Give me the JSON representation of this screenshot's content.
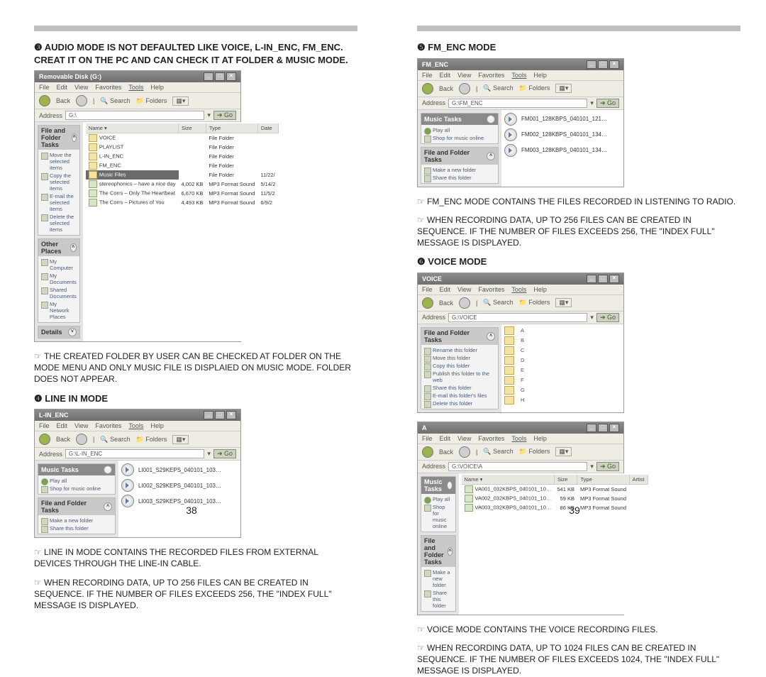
{
  "left": {
    "section3_title": "❸ AUDIO MODE IS NOT DEFAULTED LIKE VOICE, L-IN_ENC, FM_ENC. CREAT IT ON THE PC AND CAN CHECK IT AT FOLDER & MUSIC MODE.",
    "note3": "THE CREATED FOLDER BY USER CAN BE CHECKED AT FOLDER ON THE MODE MENU AND ONLY MUSIC FILE IS DISPLAIED ON MUSIC MODE. FOLDER DOES NOT APPEAR.",
    "section4_title": "❹ LINE IN MODE",
    "note4a": "LINE IN MODE CONTAINS THE RECORDED FILES FROM EXTERNAL DEVICES THROUGH THE LINE-IN CABLE.",
    "note4b": "WHEN RECORDING DATA, UP TO 256 FILES CAN BE CREATED IN SEQUENCE. IF THE NUMBER OF FILES EXCEEDS 256, THE  \"INDEX FULL\" MESSAGE IS DISPLAYED.",
    "page_num": "38",
    "win_g": {
      "title": "Removable Disk (G:)",
      "menu": [
        "File",
        "Edit",
        "View",
        "Favorites",
        "Tools",
        "Help"
      ],
      "back": "Back",
      "search": "Search",
      "folders": "Folders",
      "addr_label": "Address",
      "addr_value": "G:\\",
      "go": "Go",
      "side_tasks_hd": "File and Folder Tasks",
      "side_tasks": [
        "Move the selected items",
        "Copy the selected items",
        "E-mail the selected items",
        "Delete the selected items"
      ],
      "side_places_hd": "Other Places",
      "side_places": [
        "My Computer",
        "My Documents",
        "Shared Documents",
        "My Network Places"
      ],
      "side_details_hd": "Details",
      "cols": [
        "Name",
        "Size",
        "Type",
        "Date"
      ],
      "rows": [
        {
          "name": "VOICE",
          "size": "",
          "type": "File Folder",
          "date": ""
        },
        {
          "name": "PLAYLIST",
          "size": "",
          "type": "File Folder",
          "date": ""
        },
        {
          "name": "L-IN_ENC",
          "size": "",
          "type": "File Folder",
          "date": ""
        },
        {
          "name": "FM_ENC",
          "size": "",
          "type": "File Folder",
          "date": ""
        },
        {
          "name": "Music Files",
          "size": "",
          "type": "File Folder",
          "date": "11/22/",
          "sel": true
        },
        {
          "name": "stereophonics – have a nice day",
          "size": "4,002 KB",
          "type": "MP3 Format Sound",
          "date": "5/14/2"
        },
        {
          "name": "The Corrs – Only The Heartbeat",
          "size": "6,670 KB",
          "type": "MP3 Format Sound",
          "date": "11/5/2"
        },
        {
          "name": "The Corrs – Pictures of You",
          "size": "4,493 KB",
          "type": "MP3 Format Sound",
          "date": "6/9/2"
        }
      ]
    },
    "win_lin": {
      "title": "L-IN_ENC",
      "addr_value": "G:\\L-IN_ENC",
      "side_music_hd": "Music Tasks",
      "side_music": [
        "Play all",
        "Shop for music online"
      ],
      "side_tasks_hd": "File and Folder Tasks",
      "side_tasks": [
        "Make a new folder",
        "Share this folder"
      ],
      "items": [
        "LI001_S29KEPS_040101_103…",
        "LI002_S29KEPS_040101_103…",
        "LI003_S29KEPS_040101_103…"
      ]
    }
  },
  "right": {
    "section5_title": "❺ FM_ENC MODE",
    "note5a": "FM_ENC MODE CONTAINS THE FILES RECORDED IN LISTENING TO RADIO.",
    "note5b": "WHEN RECORDING DATA, UP TO 256 FILES CAN BE CREATED IN SEQUENCE. IF THE NUMBER OF FILES EXCEEDS 256, THE  \"INDEX FULL\" MESSAGE IS DISPLAYED.",
    "section6_title": "❻ VOICE MODE",
    "note6a": "VOICE MODE CONTAINS THE VOICE RECORDING FILES.",
    "note6b": "WHEN RECORDING DATA, UP TO 1024 FILES CAN BE CREATED IN SEQUENCE. IF THE NUMBER OF FILES EXCEEDS 1024, THE  \"INDEX FULL\" MESSAGE IS DISPLAYED.",
    "page_num": "39",
    "win_fm": {
      "title": "FM_ENC",
      "addr_value": "G:\\FM_ENC",
      "side_music_hd": "Music Tasks",
      "side_music": [
        "Play all",
        "Shop for music online"
      ],
      "side_tasks_hd": "File and Folder Tasks",
      "side_tasks": [
        "Make a new folder",
        "Share this folder"
      ],
      "items": [
        "FM001_128KBPS_040101_121…",
        "FM002_128KBPS_040101_134…",
        "FM003_128KBPS_040101_134…"
      ]
    },
    "win_voice": {
      "title": "VOICE",
      "addr_value": "G:\\VOICE",
      "side_tasks_hd": "File and Folder Tasks",
      "side_tasks": [
        "Rename this folder",
        "Move this folder",
        "Copy this folder",
        "Publish this folder to the web",
        "Share this folder",
        "E-mail this folder's files",
        "Delete this folder"
      ],
      "folders": [
        "A",
        "B",
        "C",
        "D",
        "E",
        "F",
        "G",
        "H"
      ]
    },
    "win_voice_a": {
      "title": "A",
      "addr_value": "G:\\VOICE\\A",
      "side_music_hd": "Music Tasks",
      "side_music": [
        "Play all",
        "Shop for music online"
      ],
      "side_tasks_hd": "File and Folder Tasks",
      "side_tasks": [
        "Make a new folder",
        "Share this folder"
      ],
      "cols": [
        "Name",
        "Size",
        "Type",
        "Artist"
      ],
      "rows": [
        {
          "name": "VA001_032KBPS_040101_10…",
          "size": "541 KB",
          "type": "MP3 Format Sound"
        },
        {
          "name": "VA002_032KBPS_040101_10…",
          "size": "59 KB",
          "type": "MP3 Format Sound"
        },
        {
          "name": "VA003_032KBPS_040101_10…",
          "size": "86 KB",
          "type": "MP3 Format Sound"
        }
      ]
    }
  }
}
